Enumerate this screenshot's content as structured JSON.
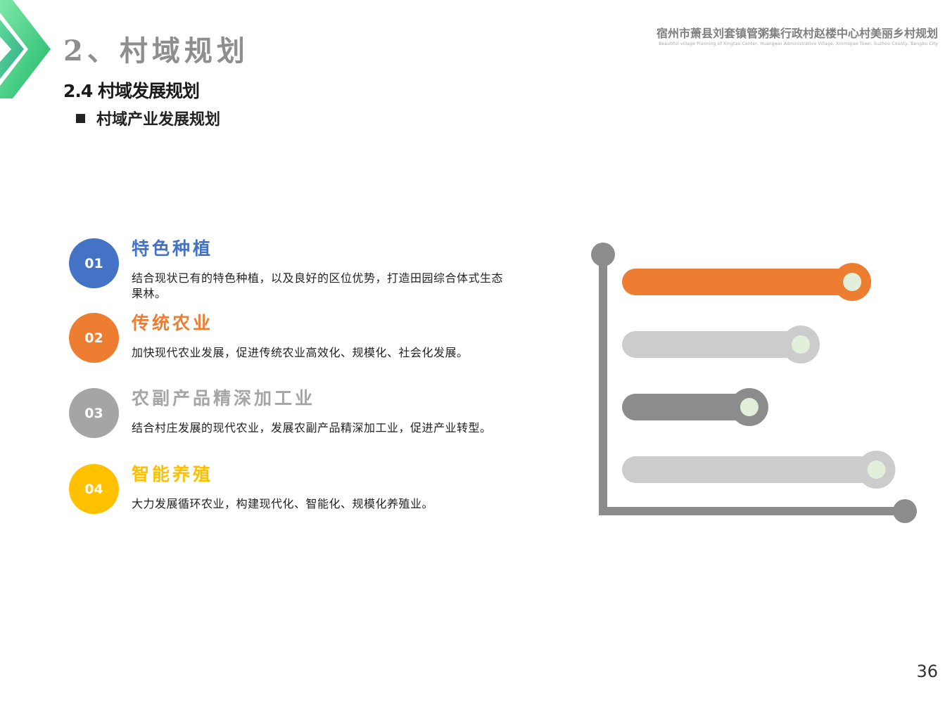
{
  "header": {
    "section_title": "2、村域规划",
    "project_title": "宿州市萧县刘套镇管粥集行政村赵楼中心村美丽乡村规划",
    "project_subtitle": "Beautiful village Planning of Xingtao Center, Huangwei Administrative Village, Xinmiqiao Town, Suzhou County, Bengbu City"
  },
  "sub_heading": "2.4 村域发展规划",
  "bullet_heading": "村域产业发展规划",
  "items": [
    {
      "number": "01",
      "title": "特色种植",
      "description": "结合现状已有的特色种植，以及良好的区位优势，打造田园综合体式生态果林。",
      "color": "#4472c4"
    },
    {
      "number": "02",
      "title": "传统农业",
      "description": "加快现代农业发展，促进传统农业高效化、规模化、社会化发展。",
      "color": "#ed7d31"
    },
    {
      "number": "03",
      "title": "农副产品精深加工业",
      "description": "结合村庄发展的现代农业，发展农副产品精深加工业，促进产业转型。",
      "color": "#a5a5a5"
    },
    {
      "number": "04",
      "title": "智能养殖",
      "description": "大力发展循环农业，构建现代化、智能化、规模化养殖业。",
      "color": "#ffc000"
    }
  ],
  "chart_data": {
    "type": "bar",
    "orientation": "horizontal",
    "values": [
      0.77,
      0.6,
      0.43,
      0.85
    ],
    "bar_colors": [
      "#ed7d31",
      "#cccccc",
      "#8c8c8c",
      "#cccccc"
    ],
    "knob_color": "#e2efda",
    "axis_color": "#8c8c8c",
    "grid": false
  },
  "page_number": "36",
  "colors": {
    "accent_green": "#2ecc71",
    "text_dark": "#1a1a1a",
    "text_gray": "#7f7f7f"
  }
}
